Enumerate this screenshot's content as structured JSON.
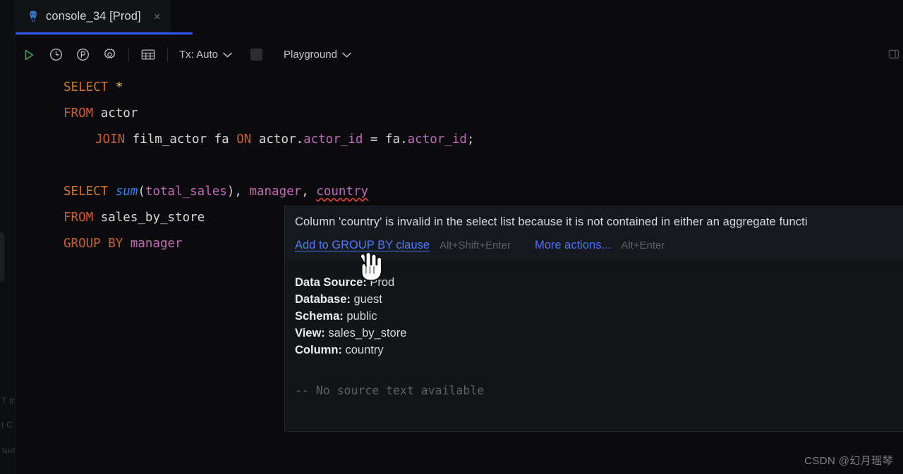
{
  "window": {
    "background_color": "#0b0b0d"
  },
  "tab": {
    "icon": "postgresql-elephant-icon",
    "title": "console_34 [Prod]",
    "close_label": "×",
    "active_underline_color": "#2f5cf6"
  },
  "toolbar": {
    "buttons": [
      {
        "name": "execute-button",
        "icon": "play-triangle-icon"
      },
      {
        "name": "history-button",
        "icon": "clock-icon"
      },
      {
        "name": "profile-button",
        "icon": "p-circle-icon"
      },
      {
        "name": "settings-button",
        "icon": "gear-icon"
      },
      {
        "name": "table-view-button",
        "icon": "table-grid-icon"
      }
    ],
    "tx_label": "Tx: Auto",
    "schema_label": "Playground",
    "stop_button_label": "",
    "right_icon": "panel-layout-icon"
  },
  "editor": {
    "statement_1": {
      "line_1": {
        "keyword": "SELECT",
        "star": "*"
      },
      "line_2": {
        "keyword": "FROM",
        "table": "actor"
      },
      "line_3": {
        "join": "JOIN",
        "table": "film_actor",
        "alias": "fa",
        "on": "ON",
        "left_ref": "actor.",
        "left_col": "actor_id",
        "eq": "=",
        "right_ref": "fa.",
        "right_col": "actor_id",
        "semicolon": ";"
      }
    },
    "statement_2": {
      "line_1": {
        "keyword": "SELECT",
        "func": "sum",
        "open": "(",
        "arg": "total_sales",
        "close": ")",
        "comma1": ", ",
        "col1": "manager",
        "comma2": ", ",
        "col2_error": "country"
      },
      "line_2": {
        "keyword": "FROM",
        "view": "sales_by_store"
      },
      "line_3": {
        "keyword": "GROUP BY",
        "col": "manager"
      }
    }
  },
  "tooltip": {
    "message": "Column 'country' is invalid in the select list because it is not contained in either an aggregate functi",
    "primary_action": "Add to GROUP BY clause",
    "primary_shortcut": "Alt+Shift+Enter",
    "secondary_action": "More actions...",
    "secondary_shortcut": "Alt+Enter",
    "meta": [
      {
        "label": "Data Source:",
        "value": "Prod"
      },
      {
        "label": "Database:",
        "value": "guest"
      },
      {
        "label": "Schema:",
        "value": "public"
      },
      {
        "label": "View:",
        "value": "sales_by_store"
      },
      {
        "label": "Column:",
        "value": "country"
      }
    ],
    "source_text": "-- No source text available",
    "link_color": "#4f7bf5"
  },
  "gutter": {
    "ghost_line_1": "T Ir",
    "ghost_line_2": "t C",
    "ghost_line_3": "นuก"
  },
  "cursor": {
    "type": "pointing-hand-cursor"
  },
  "watermark": {
    "text": "CSDN @幻月瑶琴"
  }
}
